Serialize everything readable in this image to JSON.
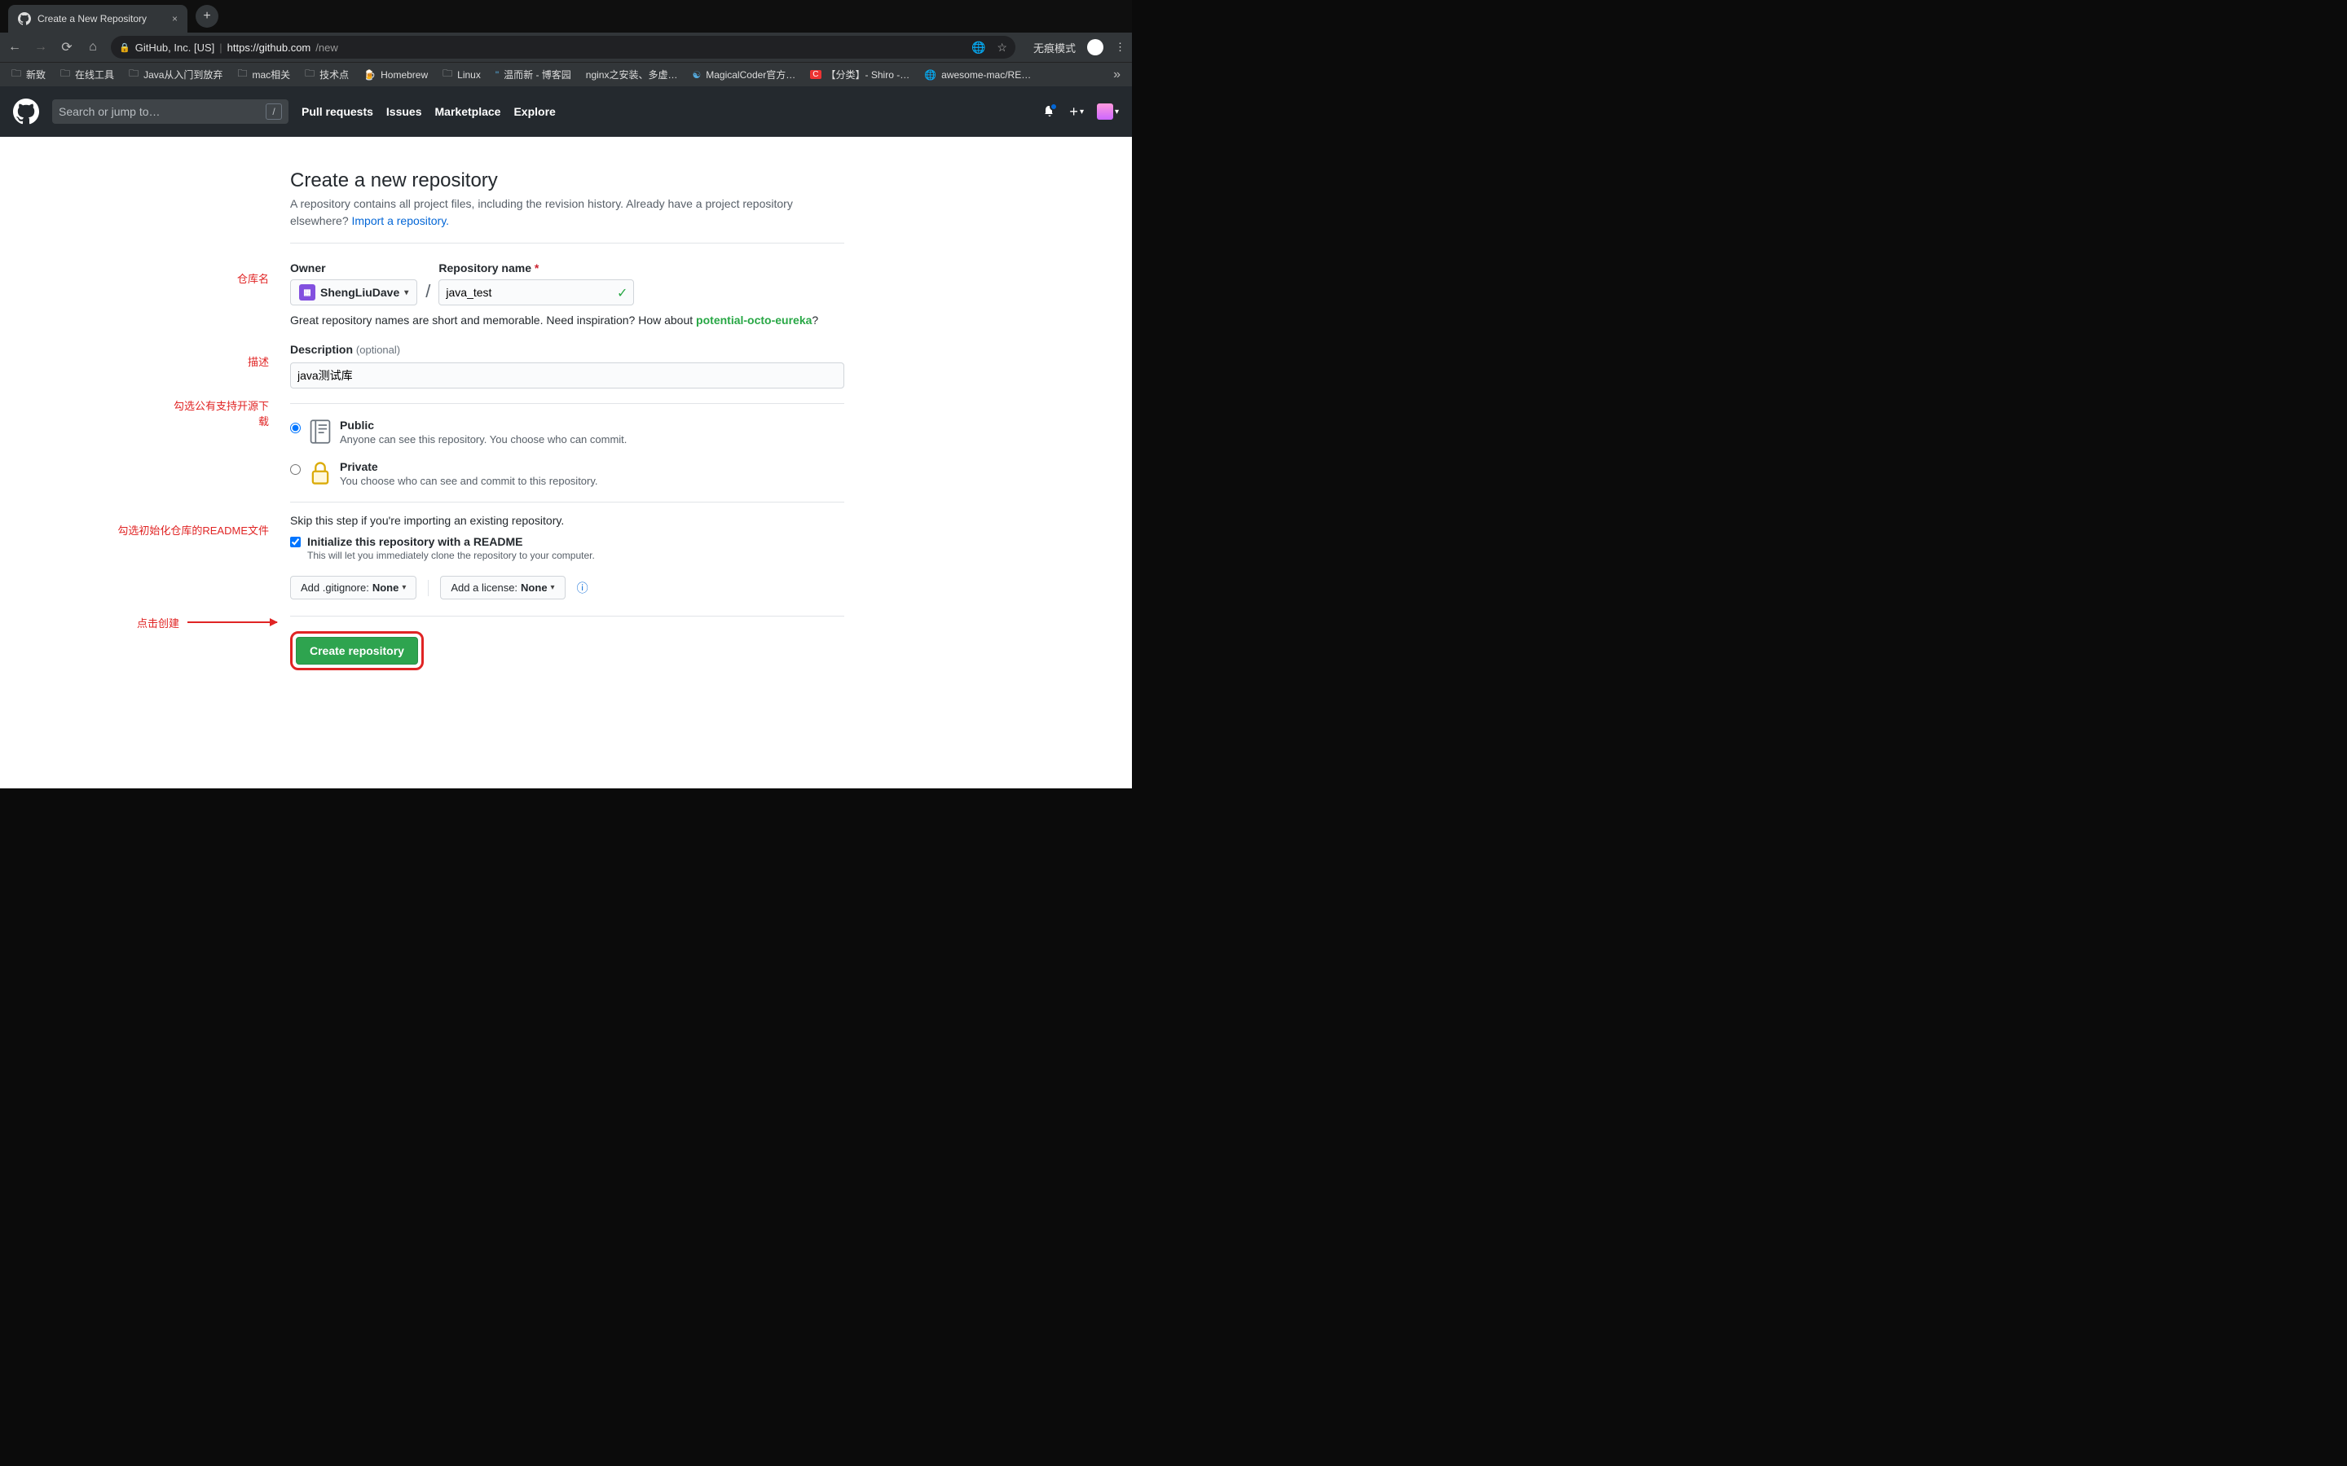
{
  "browser": {
    "tab_title": "Create a New Repository",
    "address_owner": "GitHub, Inc. [US]",
    "address_url_main": "https://github.com",
    "address_url_path": "/new",
    "incognito_label": "无痕模式",
    "bookmarks": [
      "新致",
      "在线工具",
      "Java从入门到放弃",
      "mac相关",
      "技术点",
      "Homebrew",
      "Linux",
      "温而新 - 博客园",
      "nginx之安装、多虚…",
      "MagicalCoder官方…",
      "【分类】- Shiro -…",
      "awesome-mac/RE…"
    ]
  },
  "gh_header": {
    "search_placeholder": "Search or jump to…",
    "nav": [
      "Pull requests",
      "Issues",
      "Marketplace",
      "Explore"
    ]
  },
  "page": {
    "title": "Create a new repository",
    "subtitle_a": "A repository contains all project files, including the revision history. Already have a project repository elsewhere? ",
    "subtitle_link": "Import a repository.",
    "owner_label": "Owner",
    "owner_value": "ShengLiuDave",
    "repo_label": "Repository name",
    "repo_value": "java_test",
    "hint_prefix": "Great repository names are short and memorable. Need inspiration? How about ",
    "hint_suggestion": "potential-octo-eureka",
    "hint_suffix": "?",
    "desc_label": "Description",
    "desc_optional": "(optional)",
    "desc_value": "java测试库",
    "visibility": {
      "public_title": "Public",
      "public_desc": "Anyone can see this repository. You choose who can commit.",
      "private_title": "Private",
      "private_desc": "You choose who can see and commit to this repository."
    },
    "skip_text": "Skip this step if you're importing an existing repository.",
    "init_label": "Initialize this repository with a README",
    "init_desc": "This will let you immediately clone the repository to your computer.",
    "gitignore_prefix": "Add .gitignore: ",
    "gitignore_value": "None",
    "license_prefix": "Add a license: ",
    "license_value": "None",
    "create_button": "Create repository"
  },
  "annotations": {
    "a1": "仓库名",
    "a2": "描述",
    "a3": "勾选公有支持开源下载",
    "a4": "勾选初始化仓库的README文件",
    "a5": "点击创建"
  }
}
